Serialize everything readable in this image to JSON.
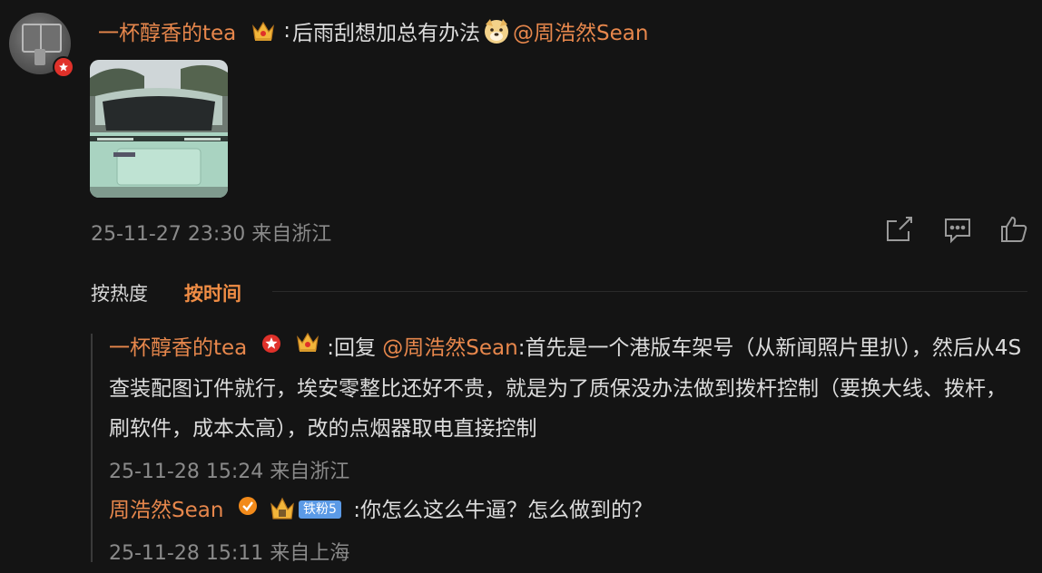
{
  "post": {
    "author": "一杯醇香的tea",
    "colon": ":",
    "text": "后雨刮想加总有办法",
    "mention": "@周浩然Sean",
    "timestamp": "25-11-27 23:30",
    "location": "来自浙江"
  },
  "sort": {
    "hot": "按热度",
    "time": "按时间"
  },
  "replies": [
    {
      "author": "一杯醇香的tea",
      "reply_label": ":回复",
      "mention": "@周浩然Sean",
      "text": ":首先是一个港版车架号（从新闻照片里扒），然后从4S查装配图订件就行，埃安零整比还好不贵，就是为了质保没办法做到拨杆控制（要换大线、拨杆，刷软件，成本太高），改的点烟器取电直接控制",
      "timestamp": "25-11-28 15:24",
      "location": "来自浙江"
    },
    {
      "author": "周浩然Sean",
      "fan_badge": "铁粉5",
      "text": ":你怎么这么牛逼？怎么做到的？",
      "timestamp": "25-11-28 15:11",
      "location": "来自上海"
    }
  ],
  "icons": {
    "share": "share-icon",
    "comment": "comment-icon",
    "like": "like-icon"
  },
  "colors": {
    "background": "#141414",
    "username": "#e7874c",
    "active_sort": "#f08d45",
    "meta": "#8a8a8a"
  }
}
